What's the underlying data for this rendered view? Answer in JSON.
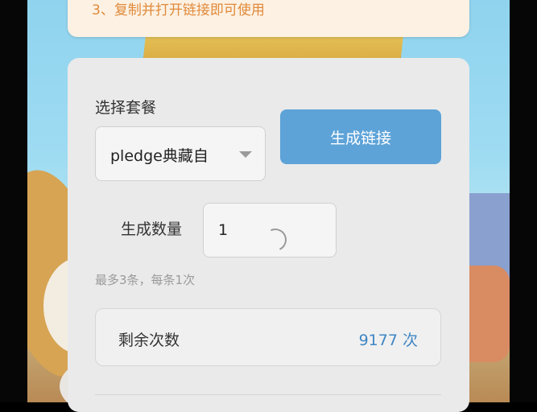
{
  "notice": {
    "text": "3、复制并打开链接即可使用"
  },
  "form": {
    "package_label": "选择套餐",
    "package_value": "pledge典藏自",
    "generate_button": "生成链接",
    "quantity_label": "生成数量",
    "quantity_value": "1",
    "hint": "最多3条，每条1次",
    "remaining_label": "剩余次数",
    "remaining_value": "9177 次"
  },
  "colors": {
    "accent": "#5da3d8",
    "remaining_value": "#3f86c4",
    "notice_text": "#e08a3a"
  }
}
